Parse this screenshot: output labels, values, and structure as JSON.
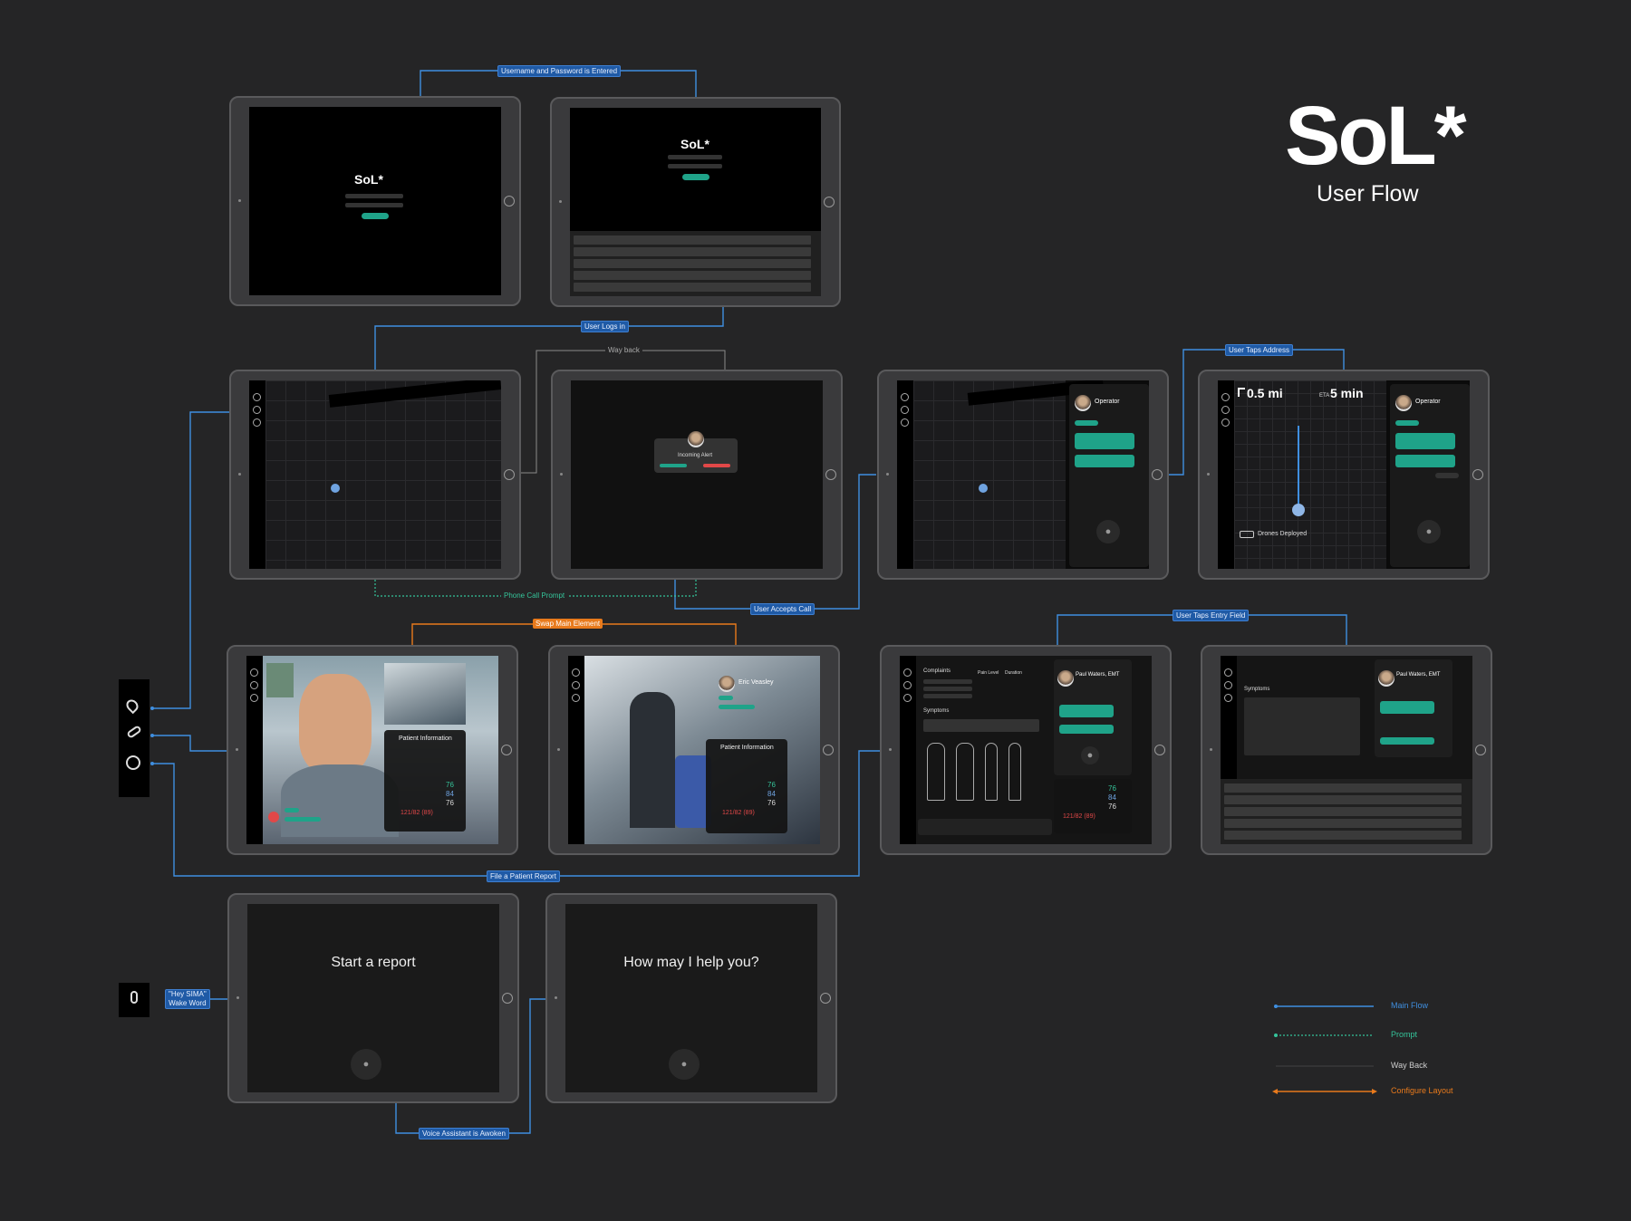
{
  "brand": {
    "logo": "SoL*",
    "subtitle": "User Flow"
  },
  "flow_labels": {
    "username_password": "Username and Password is Entered",
    "user_logs_in": "User Logs in",
    "way_back": "Way back",
    "phone_call_prompt": "Phone Call Prompt",
    "user_accepts_call": "User Accepts Call",
    "user_taps_address": "User Taps Address",
    "swap_main_element": "Swap Main Element",
    "user_taps_entry_field": "User Taps Entry Field",
    "file_patient_report": "File a Patient Report",
    "hey_sima_line1": "\"Hey SIMA\"",
    "hey_sima_line2": "Wake Word",
    "voice_assistant_awoken": "Voice Assistant is Awoken"
  },
  "screens": {
    "login": {
      "logo": "SoL*"
    },
    "login_keyboard": {
      "logo": "SoL*"
    },
    "incoming_call": {
      "title": "Incoming Alert"
    },
    "operator_map": {
      "operator_name": "Operator"
    },
    "navigation": {
      "distance": "0.5 mi",
      "eta_label": "ETA",
      "eta_value": "5 min",
      "operator_name": "Operator",
      "drones": "Drones Deployed"
    },
    "video_call": {
      "panel_title": "Patient Information",
      "vitals": [
        "76",
        "84",
        "76"
      ],
      "bp": "121/82 (89)"
    },
    "video_call_swapped": {
      "caller_name": "Eric Veasley",
      "panel_title": "Patient Information",
      "vitals": [
        "76",
        "84",
        "76"
      ],
      "bp": "121/82 (89)"
    },
    "assessment": {
      "complaints": "Complaints",
      "pain_level": "Pain Level",
      "duration": "Duration",
      "symptoms": "Symptoms",
      "contact_name": "Paul Waters, EMT",
      "vitals": [
        "76",
        "84",
        "76"
      ],
      "bp": "121/82 (89)"
    },
    "assessment_keyboard": {
      "symptoms": "Symptoms",
      "contact_name": "Paul Waters, EMT"
    },
    "start_report": {
      "prompt": "Start a report"
    },
    "voice_assistant": {
      "prompt": "How may I help you?"
    }
  },
  "legend": [
    {
      "label": "Main Flow",
      "color": "#3f8fe0",
      "style": "solid"
    },
    {
      "label": "Prompt",
      "color": "#35c49a",
      "style": "dotted"
    },
    {
      "label": "Way Back",
      "color": "#cfcfcf",
      "style": "solid"
    },
    {
      "label": "Configure Layout",
      "color": "#e87a1c",
      "style": "solid"
    }
  ],
  "colors": {
    "main_flow": "#3f8fe0",
    "prompt": "#35c49a",
    "way_back": "#8a8a8a",
    "configure": "#e87a1c",
    "accent_green": "#1fa389",
    "alert_red": "#e14848"
  },
  "side_icons": [
    "location-pin-icon",
    "phone-icon",
    "headset-icon"
  ],
  "mic_icon": "microphone-icon"
}
